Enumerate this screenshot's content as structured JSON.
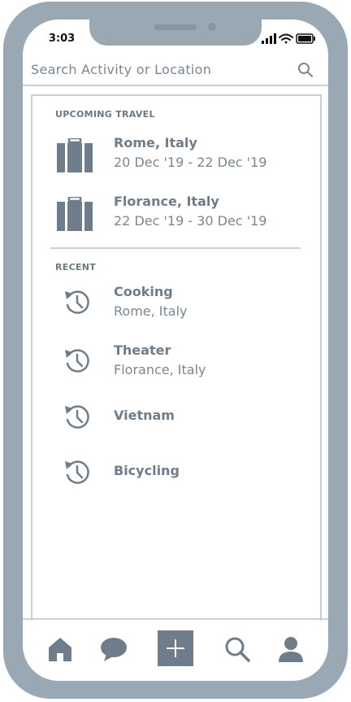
{
  "status_bar": {
    "time": "3:03"
  },
  "search": {
    "placeholder": "Search Activity or Location"
  },
  "upcoming": {
    "heading": "UPCOMING TRAVEL",
    "items": [
      {
        "title": "Rome, Italy",
        "dates": "20 Dec '19 - 22 Dec '19",
        "icon": "luggage-icon"
      },
      {
        "title": "Florance, Italy",
        "dates": "22 Dec '19 - 30 Dec '19",
        "icon": "luggage-icon"
      }
    ]
  },
  "recent": {
    "heading": "RECENT",
    "items": [
      {
        "title": "Cooking",
        "subtitle": "Rome, Italy",
        "icon": "history-icon"
      },
      {
        "title": "Theater",
        "subtitle": "Florance, Italy",
        "icon": "history-icon"
      },
      {
        "title": "Vietnam",
        "subtitle": "",
        "icon": "history-icon"
      },
      {
        "title": "Bicycling",
        "subtitle": "",
        "icon": "history-icon"
      }
    ]
  },
  "bottom_nav": {
    "items": [
      "home-icon",
      "chat-icon",
      "add-icon",
      "search-icon",
      "profile-icon"
    ],
    "active": "add-icon"
  },
  "colors": {
    "frame": "#9aa8b4",
    "icon": "#6f7d8a",
    "line": "#c9d1d8",
    "text": "#7a8793"
  }
}
